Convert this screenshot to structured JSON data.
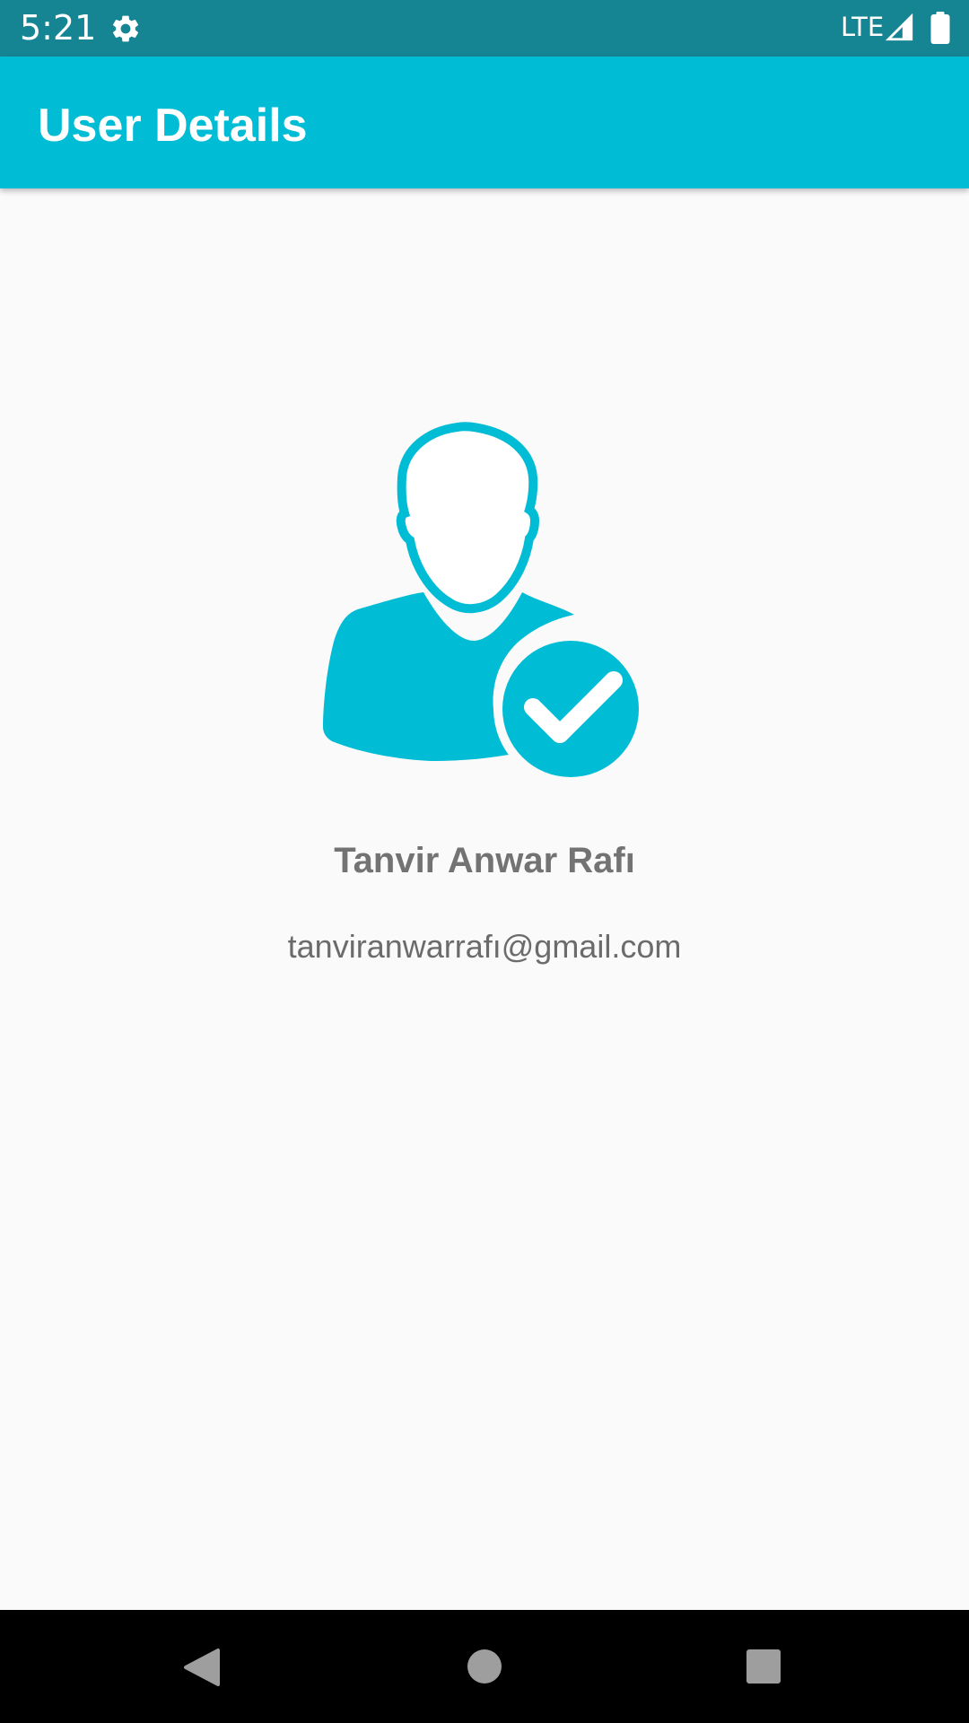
{
  "status_bar": {
    "time": "5:21",
    "network": "LTE",
    "icons": [
      "gear-icon",
      "signal-icon",
      "battery-icon"
    ],
    "background_color": "#168593"
  },
  "app_bar": {
    "title": "User Details",
    "background_color": "#00bcd4"
  },
  "profile": {
    "avatar_icon": "verified-user-icon",
    "name": "Tanvir Anwar Rafı",
    "email": "tanviranwarrafı@gmail.com",
    "accent_color": "#00bcd4"
  },
  "nav_bar": {
    "buttons": [
      "back-icon",
      "home-icon",
      "recents-icon"
    ]
  }
}
